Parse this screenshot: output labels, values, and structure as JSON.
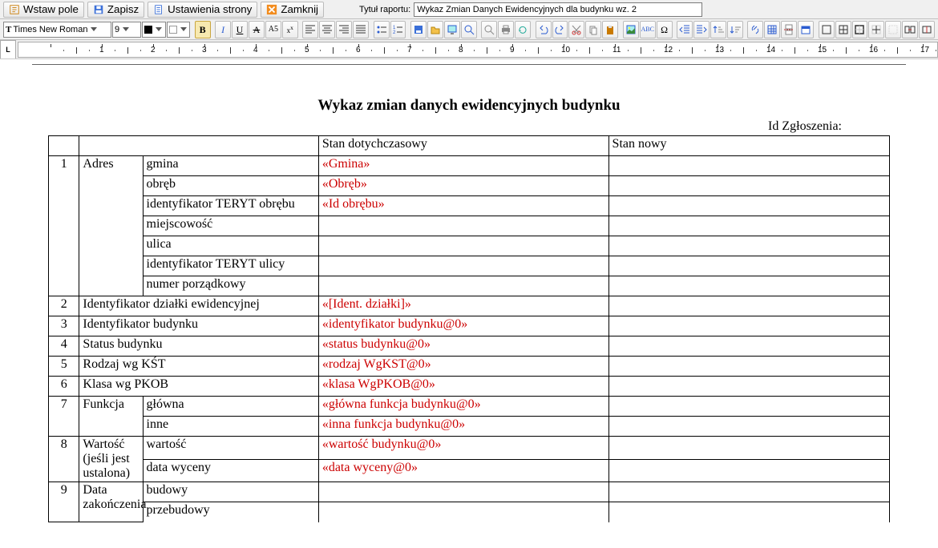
{
  "toolbar": {
    "insertField": "Wstaw pole",
    "save": "Zapisz",
    "pageSettings": "Ustawienia strony",
    "close": "Zamknij",
    "titleLabel": "Tytuł raportu:",
    "titleValue": "Wykaz Zmian Danych Ewidencyjnych dla budynku wz. 2"
  },
  "format": {
    "font": "Times New Roman",
    "size": "9",
    "bold": "B",
    "italic": "I",
    "underline": "U",
    "strike": "A",
    "A5": "A5"
  },
  "ruler": {
    "corner": "L"
  },
  "doc": {
    "title": "Wykaz zmian danych ewidencyjnych budynku",
    "idLine": "Id Zgłoszenia:",
    "hdrOld": "Stan dotychczasowy",
    "hdrNew": "Stan nowy",
    "rows": {
      "r1": {
        "n": "1",
        "lab": "Adres",
        "a": "gmina",
        "ph_a": "«Gmina»",
        "b": "obręb",
        "ph_b": "«Obręb»",
        "c": "identyfikator TERYT obrębu",
        "ph_c": "«Id obrębu»",
        "d": "miejscowość",
        "e": "ulica",
        "f": "identyfikator TERYT ulicy",
        "g": "numer porządkowy"
      },
      "r2": {
        "n": "2",
        "lab": "Identyfikator działki ewidencyjnej",
        "ph": "«[Ident. działki]»"
      },
      "r3": {
        "n": "3",
        "lab": "Identyfikator budynku",
        "ph": "«identyfikator budynku@0»"
      },
      "r4": {
        "n": "4",
        "lab": "Status budynku",
        "ph": "«status budynku@0»"
      },
      "r5": {
        "n": "5",
        "lab": "Rodzaj wg KŚT",
        "ph": "«rodzaj WgKST@0»"
      },
      "r6": {
        "n": "6",
        "lab": "Klasa wg PKOB",
        "ph": "«klasa WgPKOB@0»"
      },
      "r7": {
        "n": "7",
        "lab": "Funkcja",
        "a": "główna",
        "ph_a": "«główna funkcja budynku@0»",
        "b": "inne",
        "ph_b": "«inna funkcja  budynku@0»"
      },
      "r8": {
        "n": "8",
        "lab": "Wartość (jeśli jest ustalona)",
        "a": "wartość",
        "ph_a": "«wartość budynku@0»",
        "b": "data wyceny",
        "ph_b": "«data wyceny@0»"
      },
      "r9": {
        "n": "9",
        "lab": "Data zakończenia",
        "a": "budowy",
        "b": "przebudowy"
      }
    }
  }
}
